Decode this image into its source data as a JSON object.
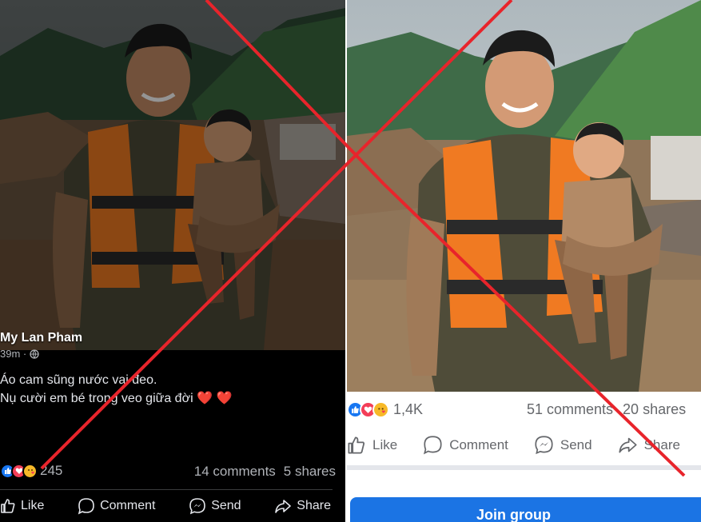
{
  "left_post": {
    "author": "My Lan Pham",
    "time": "39m ·",
    "caption_line1": "Áo cam sũng nước vai đeo.",
    "caption_line2": "Nụ cười em bé trong veo giữa đời",
    "caption_hearts": "❤️ ❤️",
    "reaction_count": "245",
    "comments": "14 comments",
    "shares": "5 shares",
    "actions": {
      "like": "Like",
      "comment": "Comment",
      "send": "Send",
      "share": "Share"
    }
  },
  "right_post": {
    "reaction_count": "1,4K",
    "comments": "51 comments",
    "shares": "20 shares",
    "actions": {
      "like": "Like",
      "comment": "Comment",
      "send": "Send",
      "share": "Share"
    },
    "join_button": "Join group"
  },
  "reactions": [
    "like-icon",
    "love-icon",
    "care-icon"
  ],
  "colors": {
    "cross": "#e8242b",
    "facebook_blue": "#1b74e4",
    "vest_orange": "#f07a22"
  }
}
